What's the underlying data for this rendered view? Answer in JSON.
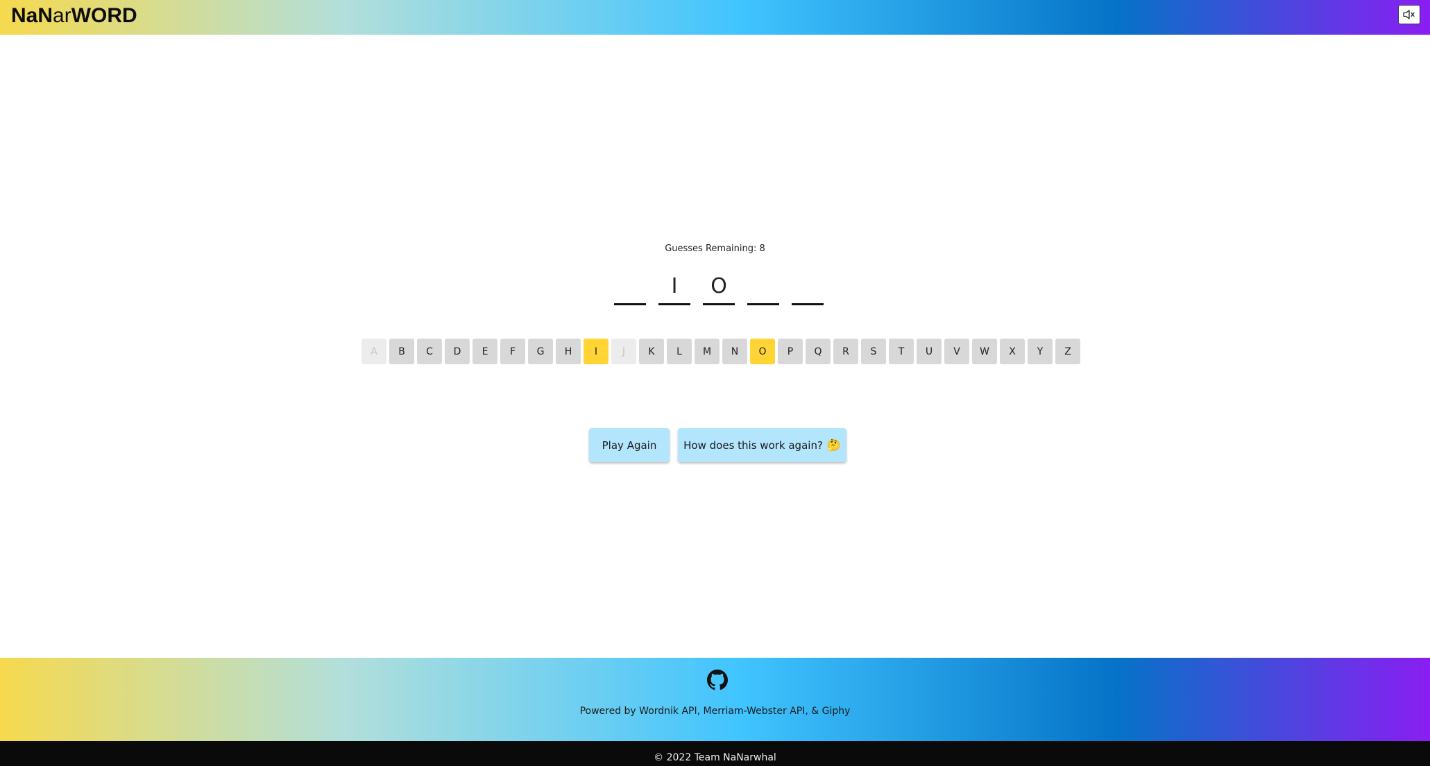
{
  "header": {
    "logo_part1": "NaN",
    "logo_part2": "ar",
    "logo_part3": "WORD",
    "mute_icon": "speaker-muted-icon"
  },
  "game": {
    "guesses_label": "Guesses Remaining: 8",
    "word_slots": [
      "",
      "I",
      "O",
      "",
      ""
    ],
    "keyboard": [
      {
        "letter": "A",
        "state": "used"
      },
      {
        "letter": "B",
        "state": "available"
      },
      {
        "letter": "C",
        "state": "available"
      },
      {
        "letter": "D",
        "state": "available"
      },
      {
        "letter": "E",
        "state": "available"
      },
      {
        "letter": "F",
        "state": "available"
      },
      {
        "letter": "G",
        "state": "available"
      },
      {
        "letter": "H",
        "state": "available"
      },
      {
        "letter": "I",
        "state": "correct"
      },
      {
        "letter": "J",
        "state": "used"
      },
      {
        "letter": "K",
        "state": "available"
      },
      {
        "letter": "L",
        "state": "available"
      },
      {
        "letter": "M",
        "state": "available"
      },
      {
        "letter": "N",
        "state": "available"
      },
      {
        "letter": "O",
        "state": "correct"
      },
      {
        "letter": "P",
        "state": "available"
      },
      {
        "letter": "Q",
        "state": "available"
      },
      {
        "letter": "R",
        "state": "available"
      },
      {
        "letter": "S",
        "state": "available"
      },
      {
        "letter": "T",
        "state": "available"
      },
      {
        "letter": "U",
        "state": "available"
      },
      {
        "letter": "V",
        "state": "available"
      },
      {
        "letter": "W",
        "state": "available"
      },
      {
        "letter": "X",
        "state": "available"
      },
      {
        "letter": "Y",
        "state": "available"
      },
      {
        "letter": "Z",
        "state": "available"
      }
    ],
    "play_again_label": "Play Again",
    "help_label": "How does this work again?",
    "help_emoji": "🤔"
  },
  "footer": {
    "github_icon": "github-icon",
    "powered_by": "Powered by Wordnik API, Merriam-Webster API, & Giphy",
    "copyright": "© 2022 Team NaNarwhal"
  },
  "colors": {
    "correct_key": "#ffd434",
    "key": "#d8d8d8",
    "used_key": "#ececec",
    "button": "#b3e5fc"
  }
}
